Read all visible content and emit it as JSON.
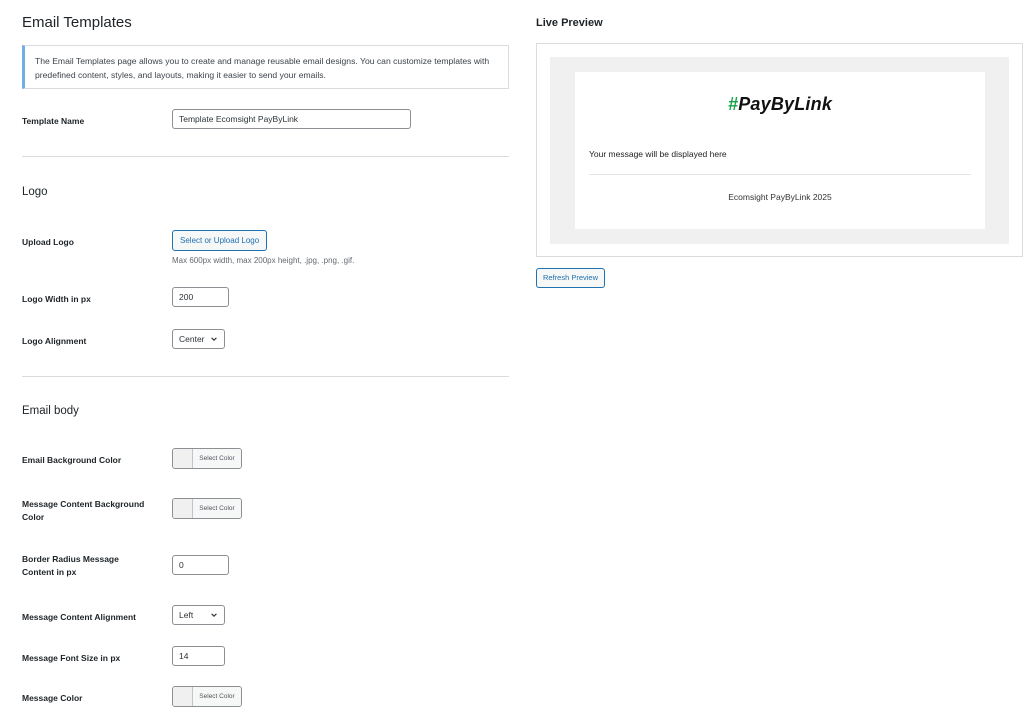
{
  "page": {
    "title": "Email Templates",
    "notice": "The Email Templates page allows you to create and manage reusable email designs. You can customize templates with predefined content, styles, and layouts, making it easier to send your emails."
  },
  "form": {
    "template_name": {
      "label": "Template Name",
      "value": "Template Ecomsight PayByLink"
    },
    "logo_section": "Logo",
    "upload_logo": {
      "label": "Upload Logo",
      "button": "Select or Upload Logo",
      "hint": "Max 600px width, max 200px height, .jpg, .png, .gif."
    },
    "logo_width": {
      "label": "Logo Width in px",
      "value": "200"
    },
    "logo_alignment": {
      "label": "Logo Alignment",
      "value": "Center"
    },
    "body_section": "Email body",
    "email_bg_color": {
      "label": "Email Background Color",
      "button": "Select Color"
    },
    "msg_bg_color": {
      "label": "Message Content Background Color",
      "button": "Select Color"
    },
    "border_radius": {
      "label": "Border Radius Message Content in px",
      "value": "0"
    },
    "msg_alignment": {
      "label": "Message Content Alignment",
      "value": "Left"
    },
    "font_size": {
      "label": "Message Font Size in px",
      "value": "14"
    },
    "msg_color": {
      "label": "Message Color",
      "button": "Select Color"
    }
  },
  "preview": {
    "title": "Live Preview",
    "logo_hash": "#",
    "logo_text": "PayByLink",
    "message": "Your message will be displayed here",
    "footer": "Ecomsight PayByLink 2025",
    "refresh_button": "Refresh Preview"
  },
  "colors": {
    "accent": "#2271b1",
    "notice_border": "#72aee6",
    "logo_hash": "#18a34a",
    "email_bg": "#f0f0f1"
  },
  "icons": {
    "select_arrow": "chevron-down-icon"
  }
}
